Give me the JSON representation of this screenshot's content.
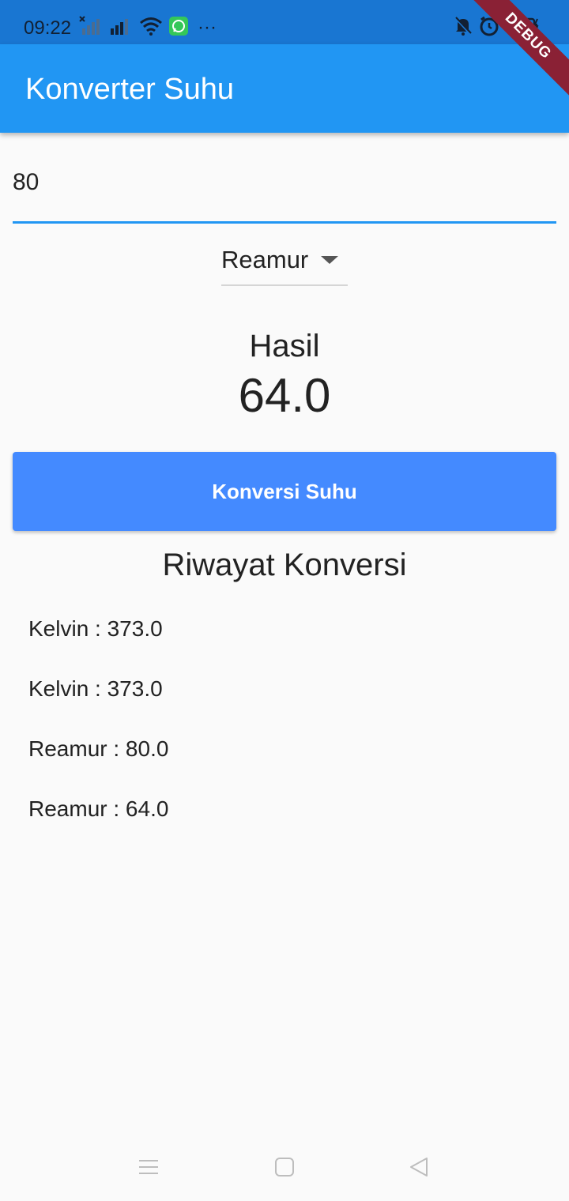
{
  "status_bar": {
    "time": "09:22",
    "more_indicator": "···",
    "debug_label": "DEBUG"
  },
  "app_bar": {
    "title": "Konverter Suhu"
  },
  "input": {
    "value": "80"
  },
  "unit_dropdown": {
    "selected": "Reamur"
  },
  "result": {
    "label": "Hasil",
    "value": "64.0"
  },
  "convert_button": {
    "label": "Konversi Suhu"
  },
  "history": {
    "title": "Riwayat Konversi",
    "items": [
      "Kelvin : 373.0",
      "Kelvin : 373.0",
      "Reamur : 80.0",
      "Reamur : 64.0"
    ]
  },
  "nav_bar": {
    "icons": [
      "menu-icon",
      "home-square-icon",
      "back-triangle-icon"
    ]
  },
  "colors": {
    "status_bar": "#1976d2",
    "app_bar": "#2196f3",
    "button": "#448aff",
    "input_underline": "#2196f3",
    "debug_banner": "#8a2135"
  }
}
